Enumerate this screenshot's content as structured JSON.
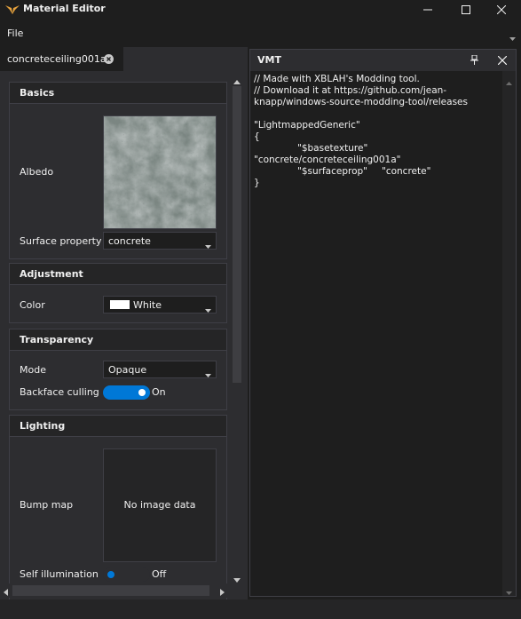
{
  "window": {
    "title": "Material Editor"
  },
  "menu": {
    "file_label": "File"
  },
  "tab": {
    "label": "concreteceiling001a"
  },
  "groups": {
    "basics": {
      "title": "Basics",
      "albedo_label": "Albedo",
      "surface_label": "Surface property",
      "surface_value": "concrete"
    },
    "adjustment": {
      "title": "Adjustment",
      "color_label": "Color",
      "color_value": "White",
      "color_hex": "#ffffff"
    },
    "transparency": {
      "title": "Transparency",
      "mode_label": "Mode",
      "mode_value": "Opaque",
      "backface_label": "Backface culling",
      "backface_state": "On"
    },
    "lighting": {
      "title": "Lighting",
      "bump_label": "Bump map",
      "bump_placeholder": "No image data",
      "self_illum_label": "Self illumination",
      "self_illum_state": "Off"
    }
  },
  "vmt": {
    "title": "VMT",
    "lines": [
      "// Made with XBLAH's Modding tool.",
      "// Download it at https://github.com/jean-",
      "knapp/windows-source-modding-tool/releases",
      "\"LightmappedGeneric\"",
      "{",
      "\"$basetexture\"",
      "\"concrete/concreteceiling001a\"",
      "\"$surfaceprop\"",
      "\"concrete\"",
      "}"
    ]
  },
  "colors": {
    "accent": "#0078d7",
    "background": "#2d2d30",
    "editor": "#1e1e1e",
    "border": "#3f3f46",
    "app_icon": "#e8a33d"
  },
  "icons": {
    "app": "wings-logo-icon",
    "minimize": "minimize-icon",
    "maximize": "maximize-icon",
    "close": "close-icon",
    "pin": "pin-icon"
  }
}
